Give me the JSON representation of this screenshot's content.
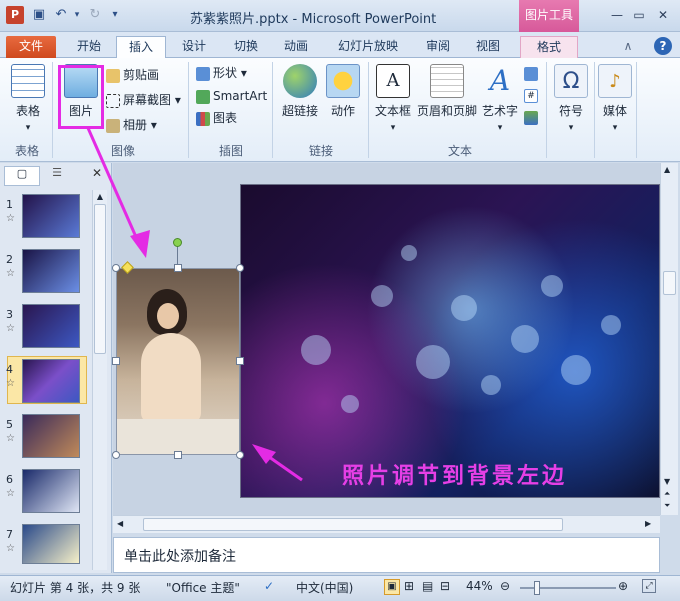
{
  "window": {
    "title": "苏紫紫照片.pptx - Microsoft PowerPoint",
    "context_tab": "图片工具"
  },
  "tabs": [
    "文件",
    "开始",
    "插入",
    "设计",
    "切换",
    "动画",
    "幻灯片放映",
    "审阅",
    "视图",
    "格式"
  ],
  "ribbon": {
    "groups": {
      "tables": "表格",
      "images": "图像",
      "illustrations": "插图",
      "links": "链接",
      "text": "文本"
    },
    "buttons": {
      "table": "表格",
      "picture": "图片",
      "clipart": "剪贴画",
      "screenshot": "屏幕截图",
      "album": "相册",
      "shapes": "形状",
      "smartart": "SmartArt",
      "chart": "图表",
      "hyperlink": "超链接",
      "action": "动作",
      "textbox": "文本框",
      "header_footer": "页眉和页脚",
      "wordart": "艺术字",
      "symbol": "符号",
      "media": "媒体"
    }
  },
  "slides": [
    "1",
    "2",
    "3",
    "4",
    "5",
    "6",
    "7"
  ],
  "selected_slide": "4",
  "slide": {
    "caption": "照片调节到背景左边"
  },
  "notes": {
    "placeholder": "单击此处添加备注"
  },
  "status": {
    "slide_info": "幻灯片 第 4 张，共 9 张",
    "theme": "\"Office 主题\"",
    "language": "中文(中国)",
    "zoom": "44%"
  },
  "colors": {
    "annotation": "#e42be4",
    "file_tab": "#d9552a",
    "context_tab": "#d7599a"
  }
}
